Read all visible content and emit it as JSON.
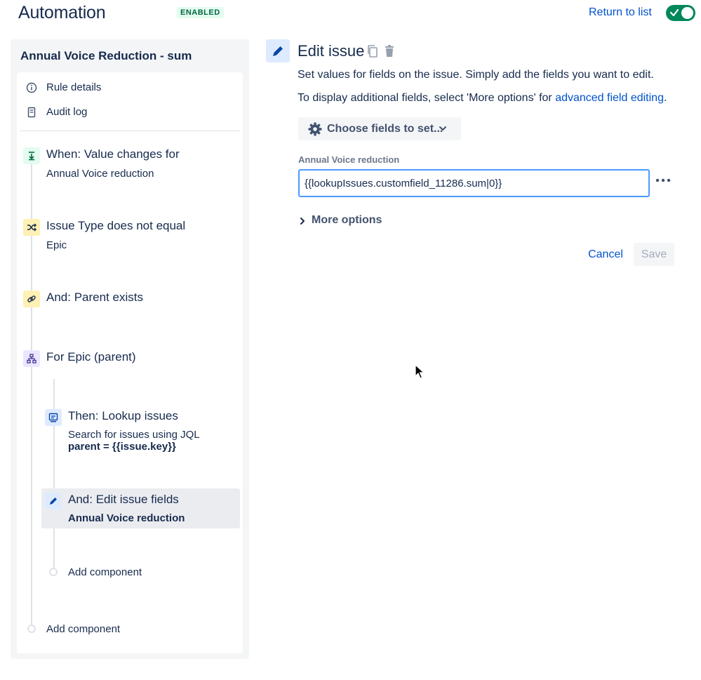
{
  "header": {
    "title": "Automation",
    "status": "ENABLED",
    "return_link": "Return to list",
    "toggle_on": true
  },
  "sidebar": {
    "rule_name": "Annual Voice Reduction - sum",
    "menu": [
      {
        "label": "Rule details",
        "icon": "info-icon"
      },
      {
        "label": "Audit log",
        "icon": "audit-log-icon"
      }
    ],
    "steps": [
      {
        "title": "When: Value changes for",
        "subtitle": "Annual Voice reduction",
        "icon": "trigger-icon",
        "color": "#E3FCEF"
      },
      {
        "title": "Issue Type does not equal",
        "subtitle": "Epic",
        "icon": "shuffle-icon",
        "color": "#FFF0B3"
      },
      {
        "title": "And: Parent exists",
        "icon": "link-icon",
        "color": "#FFF0B3"
      },
      {
        "title": "For Epic (parent)",
        "icon": "hierarchy-icon",
        "color": "#EAE6FF"
      },
      {
        "title": "Then: Lookup issues",
        "subtitle": "Search for issues using JQL",
        "subtitle2": "parent = {{issue.key}}",
        "icon": "lookup-icon",
        "color": "#DEEBFF"
      },
      {
        "title": "And: Edit issue fields",
        "subtitle": "Annual Voice reduction",
        "icon": "pencil-icon",
        "color": "#DEEBFF"
      }
    ],
    "add_component_nested": "Add component",
    "add_component": "Add component"
  },
  "panel": {
    "title": "Edit issue",
    "desc1": "Set values for fields on the issue. Simply add the fields you want to edit.",
    "desc2_prefix": "To display additional fields, select 'More options' for ",
    "desc2_link": "advanced field editing",
    "desc2_suffix": ".",
    "choose_fields": "Choose fields to set...",
    "field_label": "Annual Voice reduction",
    "field_value": "{{lookupIssues.customfield_11286.sum|0}}",
    "more_options": "More options",
    "cancel": "Cancel",
    "save": "Save"
  },
  "colors": {
    "accent": "#0052CC",
    "success": "#00875A",
    "text": "#172B4D"
  }
}
